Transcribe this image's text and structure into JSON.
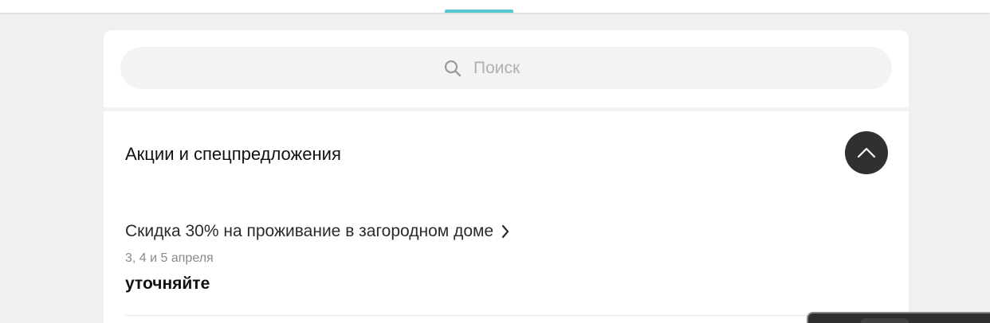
{
  "search": {
    "placeholder": "Поиск",
    "icon": "search-icon"
  },
  "section": {
    "title": "Акции и спецпредложения",
    "toggle_icon": "chevron-up-icon"
  },
  "offer": {
    "title": "Скидка 30% на проживание в загородном доме",
    "link_icon": "chevron-right-icon",
    "dates": "3, 4 и 5 апреля",
    "price": "уточняйте"
  },
  "colors": {
    "accent": "#55c9cf",
    "page_background": "#f0f0f0",
    "card_background": "#ffffff",
    "toggle_background": "#303030"
  }
}
